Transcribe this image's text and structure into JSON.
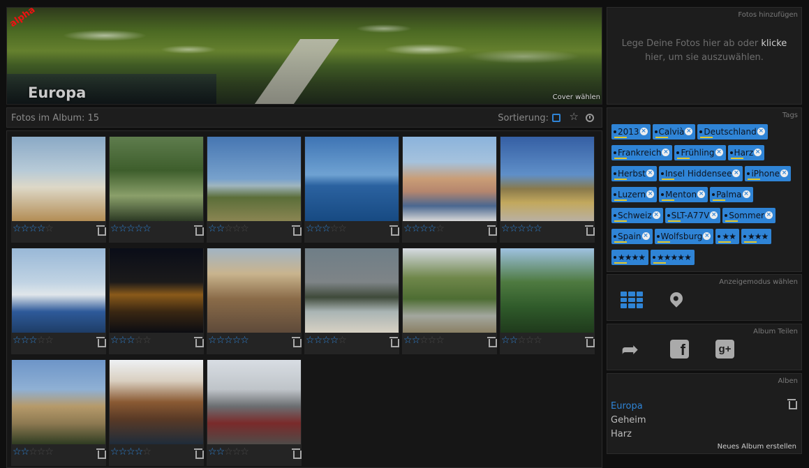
{
  "cover": {
    "badge": "alpha",
    "title": "Europa",
    "choose_cover": "Cover wählen"
  },
  "album_bar": {
    "count_label": "Fotos im Album: 15",
    "sort_label": "Sortierung:"
  },
  "photos": [
    {
      "rating": 4
    },
    {
      "rating": 5
    },
    {
      "rating": 2
    },
    {
      "rating": 3
    },
    {
      "rating": 4
    },
    {
      "rating": 5
    },
    {
      "rating": 3
    },
    {
      "rating": 3
    },
    {
      "rating": 5
    },
    {
      "rating": 4
    },
    {
      "rating": 2
    },
    {
      "rating": 2
    },
    {
      "rating": 2
    },
    {
      "rating": 4
    },
    {
      "rating": 2
    }
  ],
  "upload": {
    "title": "Fotos hinzufügen",
    "text_before": "Lege Deine Fotos hier ab oder ",
    "link": "klicke",
    "text_after": " hier, um sie auszuwählen."
  },
  "tags": {
    "title": "Tags",
    "items": [
      "2013",
      "Calvià",
      "Deutschland",
      "Frankreich",
      "Frühling",
      "Harz",
      "Herbst",
      "Insel Hiddensee",
      "iPhone",
      "Luzern",
      "Menton",
      "Palma",
      "Schweiz",
      "SLT-A77V",
      "Sommer",
      "Spain",
      "Wolfsburg"
    ],
    "star_tags": [
      "★★",
      "★★★",
      "★★★★",
      "★★★★★"
    ]
  },
  "view_mode": {
    "title": "Anzeigemodus wählen",
    "icons": [
      "grid-icon",
      "map-pin-icon"
    ]
  },
  "share": {
    "title": "Album Teilen",
    "icons": [
      "share-icon",
      "facebook-icon",
      "google-plus-icon"
    ]
  },
  "albums": {
    "title": "Alben",
    "items": [
      "Europa",
      "Geheim",
      "Harz"
    ],
    "new_album": "Neues Album erstellen"
  },
  "colors": {
    "accent": "#2f84d6",
    "background": "#0f0f0f",
    "panel": "#1d1d1d"
  }
}
